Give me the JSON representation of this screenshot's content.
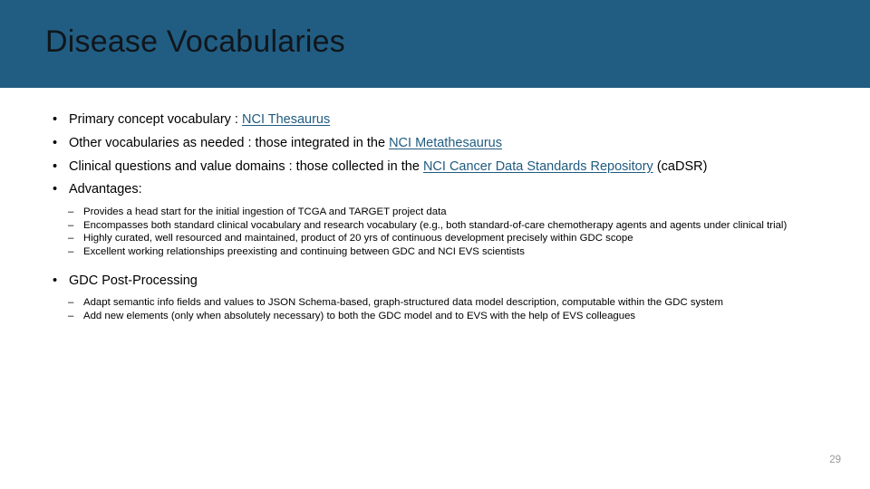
{
  "slide": {
    "title": "Disease Vocabularies",
    "page_number": "29",
    "banner_color": "#215d82",
    "link_color": "#1f5b80",
    "text_color": "#000000"
  },
  "bullets": [
    {
      "bullet_glyph": "•",
      "segments": [
        {
          "text": "Primary concept vocabulary : ",
          "link": false
        },
        {
          "text": "NCI Thesaurus",
          "link": true
        }
      ]
    },
    {
      "bullet_glyph": "•",
      "segments": [
        {
          "text": "Other vocabularies as needed : those integrated in the ",
          "link": false
        },
        {
          "text": "NCI Metathesaurus",
          "link": true
        }
      ]
    },
    {
      "bullet_glyph": "•",
      "segments": [
        {
          "text": "Clinical questions and value domains : those collected in the ",
          "link": false
        },
        {
          "text": "NCI Cancer Data Standards Repository",
          "link": true
        },
        {
          "text": " (caDSR)",
          "link": false
        }
      ]
    },
    {
      "bullet_glyph": "•",
      "segments": [
        {
          "text": "Advantages:",
          "link": false
        }
      ]
    }
  ],
  "advantages_subbullets": [
    {
      "dash_glyph": "–",
      "text": "Provides a head start for the initial ingestion of TCGA and TARGET project data"
    },
    {
      "dash_glyph": "–",
      "text": "Encompasses both standard clinical vocabulary and research vocabulary (e.g., both standard-of-care chemotherapy agents and agents under clinical trial)"
    },
    {
      "dash_glyph": "–",
      "text": "Highly curated, well resourced and maintained, product of 20 yrs of continuous development precisely within GDC scope"
    },
    {
      "dash_glyph": "–",
      "text": "Excellent working relationships preexisting and continuing between GDC and NCI EVS scientists"
    }
  ],
  "postprocessing": {
    "bullet_glyph": "•",
    "heading": "GDC Post-Processing",
    "subbullets": [
      {
        "dash_glyph": "–",
        "text": "Adapt semantic info fields and values to JSON Schema-based, graph-structured data model description, computable within the GDC system"
      },
      {
        "dash_glyph": "–",
        "text": "Add new elements (only when absolutely necessary) to both the GDC model and to EVS with the help of EVS colleagues"
      }
    ]
  }
}
